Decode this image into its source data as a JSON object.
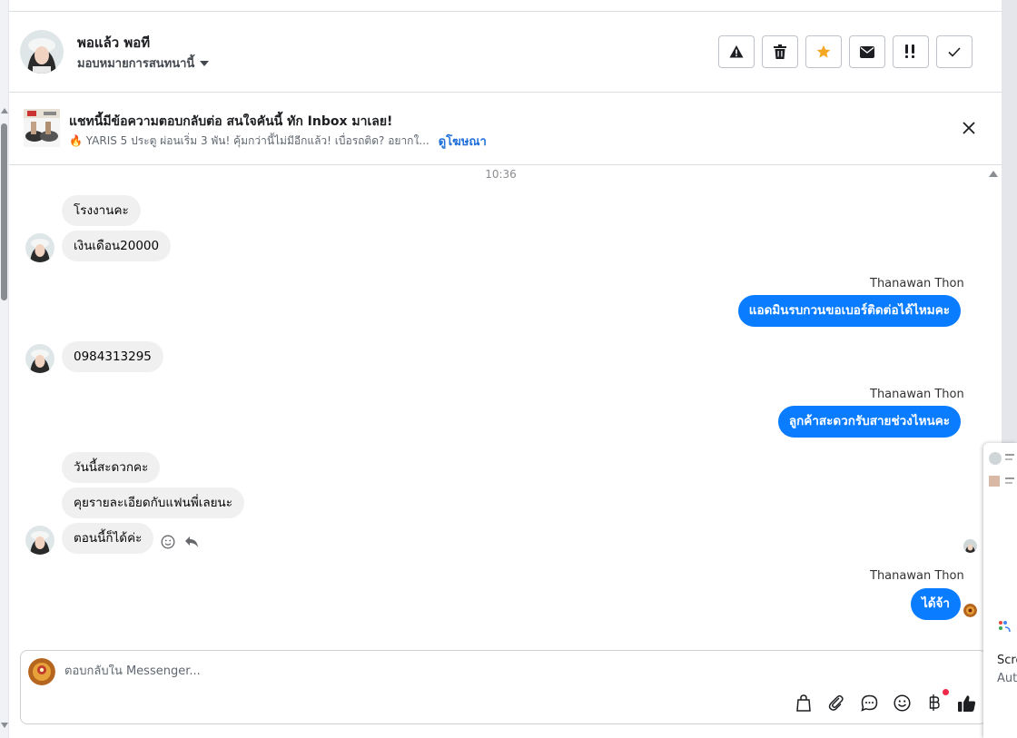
{
  "header": {
    "name": "พอแล้ว พอที",
    "assign_label": "มอบหมายการสนทนานี้",
    "actions": [
      "warning-icon",
      "trash-icon",
      "star-icon",
      "mail-icon",
      "spam-icon",
      "check-icon"
    ]
  },
  "ad": {
    "title": "แชทนี้มีข้อความตอบกลับต่อ สนใจคันนี้ ทัก Inbox มาเลย!",
    "subtitle": "🔥 YARIS 5 ประตู ผ่อนเริ่ม 3 พัน! คุ้มกว่านี้ไม่มีอีกแล้ว! เบื่อรถติด? อยากใ...",
    "link": "ดูโฆษณา"
  },
  "chat": {
    "timestamp": "10:36",
    "messages": [
      {
        "from": "customer",
        "text": "โรงงานคะ"
      },
      {
        "from": "customer",
        "text": "เงินเดือน20000"
      },
      {
        "from": "agent",
        "sender": "Thanawan Thon",
        "text": "แอดมินรบกวนขอเบอร์ติดต่อได้ไหมคะ"
      },
      {
        "from": "customer",
        "text": "0984313295"
      },
      {
        "from": "agent",
        "sender": "Thanawan Thon",
        "text": "ลูกค้าสะดวกรับสายช่วงไหนคะ"
      },
      {
        "from": "customer",
        "text": "วันนี้สะดวกคะ"
      },
      {
        "from": "customer",
        "text": "คุยรายละเอียดกับแฟนพี่เลยนะ"
      },
      {
        "from": "customer",
        "text": "ตอนนี้ก็ได้ค่ะ"
      },
      {
        "from": "agent",
        "sender": "Thanawan Thon",
        "text": "ได้จ้า"
      }
    ]
  },
  "composer": {
    "placeholder": "ตอบกลับใน Messenger...",
    "tools": [
      "shopping-bag-icon",
      "attachment-icon",
      "saved-reply-icon",
      "emoji-icon",
      "baht-icon",
      "thumbs-up-icon"
    ]
  },
  "side_popup": {
    "line1": "Scre",
    "line2": "Aut"
  },
  "colors": {
    "outgoing_bubble": "#0a7cff",
    "incoming_bubble": "#f0f0f0",
    "star": "#f5a623"
  }
}
